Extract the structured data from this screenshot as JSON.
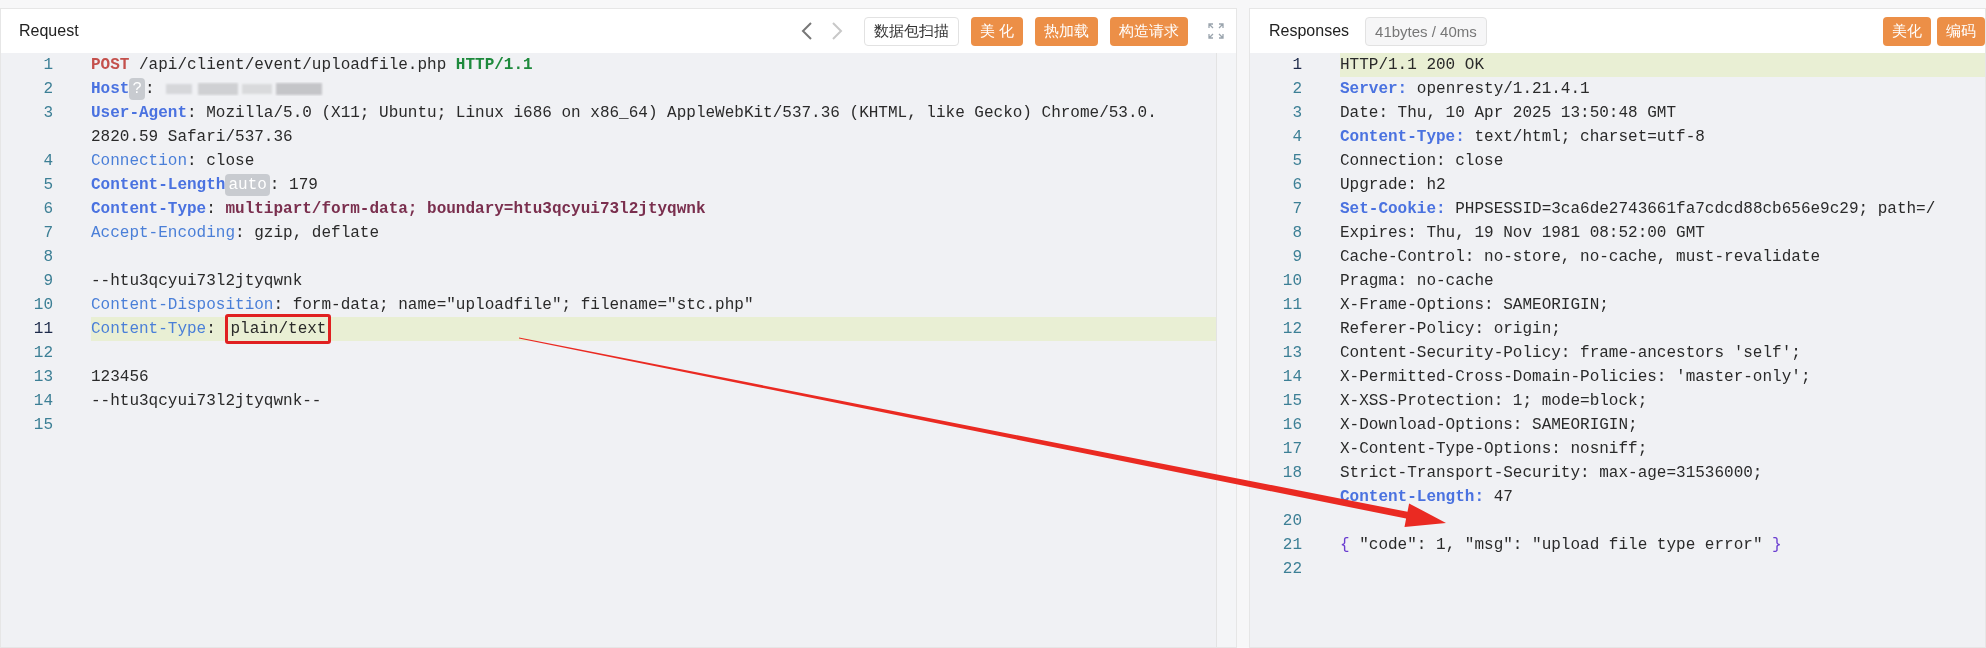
{
  "request": {
    "title": "Request",
    "toolbar": [
      {
        "kind": "back",
        "disabled": false
      },
      {
        "kind": "forward",
        "disabled": true
      },
      {
        "kind": "outline",
        "label": "数据包扫描"
      },
      {
        "kind": "primary",
        "label": "美 化"
      },
      {
        "kind": "primary",
        "label": "热加载"
      },
      {
        "kind": "primary",
        "label": "构造请求"
      },
      {
        "kind": "fullscreen"
      }
    ],
    "lines": [
      {
        "number": "1",
        "current": false,
        "segments": [
          {
            "kind": "method",
            "text": "POST"
          },
          {
            "kind": "plain",
            "text": " /api/client/event/uploadfile.php "
          },
          {
            "kind": "proto",
            "text": "HTTP/1.1"
          }
        ]
      },
      {
        "number": "2",
        "current": false,
        "segments": [
          {
            "kind": "key",
            "text": "Host"
          },
          {
            "kind": "badge",
            "text": "?"
          },
          {
            "kind": "plain",
            "text": ": "
          },
          {
            "kind": "redacted"
          }
        ]
      },
      {
        "number": "3",
        "current": false,
        "segments": [
          {
            "kind": "key",
            "text": "User-Agent"
          },
          {
            "kind": "plain",
            "text": ": Mozilla/5.0 (X11; Ubuntu; Linux i686 on x86_64) AppleWebKit/537.36 (KHTML, like Gecko) Chrome/53.0."
          }
        ],
        "continuation": "2820.59 Safari/537.36"
      },
      {
        "number": "4",
        "current": false,
        "segments": [
          {
            "kind": "name",
            "text": "Connection"
          },
          {
            "kind": "plain",
            "text": ": close"
          }
        ]
      },
      {
        "number": "5",
        "current": false,
        "segments": [
          {
            "kind": "key",
            "text": "Content-Length"
          },
          {
            "kind": "badge",
            "text": "auto"
          },
          {
            "kind": "plain",
            "text": ": 179"
          }
        ]
      },
      {
        "number": "6",
        "current": false,
        "segments": [
          {
            "kind": "key",
            "text": "Content-Type"
          },
          {
            "kind": "plain",
            "text": ": "
          },
          {
            "kind": "strong",
            "text": "multipart/form-data; boundary=htu3qcyui73l2jtyqwnk"
          }
        ]
      },
      {
        "number": "7",
        "current": false,
        "segments": [
          {
            "kind": "name",
            "text": "Accept-Encoding"
          },
          {
            "kind": "plain",
            "text": ": gzip, deflate"
          }
        ]
      },
      {
        "number": "8",
        "current": false
      },
      {
        "number": "9",
        "current": false,
        "segments": [
          {
            "kind": "plain",
            "text": "--htu3qcyui73l2jtyqwnk"
          }
        ]
      },
      {
        "number": "10",
        "current": false,
        "segments": [
          {
            "kind": "name",
            "text": "Content-Disposition"
          },
          {
            "kind": "plain",
            "text": ": form-data; name=\"uploadfile\"; filename=\"stc.php\""
          }
        ]
      },
      {
        "number": "11",
        "current": true,
        "segments": [
          {
            "kind": "name",
            "text": "Content-Type"
          },
          {
            "kind": "plain",
            "text": ": "
          },
          {
            "kind": "boxed",
            "text": "plain/text"
          }
        ]
      },
      {
        "number": "12",
        "current": false
      },
      {
        "number": "13",
        "current": false,
        "segments": [
          {
            "kind": "plain",
            "text": "123456"
          }
        ]
      },
      {
        "number": "14",
        "current": false,
        "segments": [
          {
            "kind": "plain",
            "text": "--htu3qcyui73l2jtyqwnk--"
          }
        ]
      },
      {
        "number": "15",
        "current": false
      }
    ]
  },
  "response": {
    "title": "Responses",
    "stats": "41bytes / 40ms",
    "buttons": [
      "美化",
      "编码"
    ],
    "lines": [
      {
        "number": "1",
        "current": true,
        "segments": [
          {
            "kind": "plain",
            "text": "HTTP/1.1 200 OK"
          }
        ]
      },
      {
        "number": "2",
        "current": false,
        "segments": [
          {
            "kind": "key",
            "text": "Server:"
          },
          {
            "kind": "plain",
            "text": " openresty/1.21.4.1"
          }
        ]
      },
      {
        "number": "3",
        "current": false,
        "segments": [
          {
            "kind": "plain",
            "text": "Date: Thu, 10 Apr 2025 13:50:48 GMT"
          }
        ]
      },
      {
        "number": "4",
        "current": false,
        "segments": [
          {
            "kind": "key",
            "text": "Content-Type:"
          },
          {
            "kind": "plain",
            "text": " text/html; charset=utf-8"
          }
        ]
      },
      {
        "number": "5",
        "current": false,
        "segments": [
          {
            "kind": "plain",
            "text": "Connection: close"
          }
        ]
      },
      {
        "number": "6",
        "current": false,
        "segments": [
          {
            "kind": "plain",
            "text": "Upgrade: h2"
          }
        ]
      },
      {
        "number": "7",
        "current": false,
        "segments": [
          {
            "kind": "key",
            "text": "Set-Cookie:"
          },
          {
            "kind": "plain",
            "text": " PHPSESSID=3ca6de2743661fa7cdcd88cb656e9c29; path=/"
          }
        ]
      },
      {
        "number": "8",
        "current": false,
        "segments": [
          {
            "kind": "plain",
            "text": "Expires: Thu, 19 Nov 1981 08:52:00 GMT"
          }
        ]
      },
      {
        "number": "9",
        "current": false,
        "segments": [
          {
            "kind": "plain",
            "text": "Cache-Control: no-store, no-cache, must-revalidate"
          }
        ]
      },
      {
        "number": "10",
        "current": false,
        "segments": [
          {
            "kind": "plain",
            "text": "Pragma: no-cache"
          }
        ]
      },
      {
        "number": "11",
        "current": false,
        "segments": [
          {
            "kind": "plain",
            "text": "X-Frame-Options: SAMEORIGIN;"
          }
        ]
      },
      {
        "number": "12",
        "current": false,
        "segments": [
          {
            "kind": "plain",
            "text": "Referer-Policy: origin;"
          }
        ]
      },
      {
        "number": "13",
        "current": false,
        "segments": [
          {
            "kind": "plain",
            "text": "Content-Security-Policy: frame-ancestors 'self';"
          }
        ]
      },
      {
        "number": "14",
        "current": false,
        "segments": [
          {
            "kind": "plain",
            "text": "X-Permitted-Cross-Domain-Policies: 'master-only';"
          }
        ]
      },
      {
        "number": "15",
        "current": false,
        "segments": [
          {
            "kind": "plain",
            "text": "X-XSS-Protection: 1; mode=block;"
          }
        ]
      },
      {
        "number": "16",
        "current": false,
        "segments": [
          {
            "kind": "plain",
            "text": "X-Download-Options: SAMEORIGIN;"
          }
        ]
      },
      {
        "number": "17",
        "current": false,
        "segments": [
          {
            "kind": "plain",
            "text": "X-Content-Type-Options: nosniff;"
          }
        ]
      },
      {
        "number": "18",
        "current": false,
        "segments": [
          {
            "kind": "plain",
            "text": "Strict-Transport-Security: max-age=31536000;"
          }
        ]
      },
      {
        "current": false,
        "segments": [
          {
            "kind": "key",
            "text": "Content-Length:"
          },
          {
            "kind": "plain",
            "text": " 47"
          }
        ]
      },
      {
        "number": "20",
        "current": false
      },
      {
        "number": "21",
        "current": false,
        "segments": [
          {
            "kind": "brace",
            "text": "{"
          },
          {
            "kind": "plain",
            "text": " \"code\": 1, \"msg\": \"upload file type error\" "
          },
          {
            "kind": "brace",
            "text": "}"
          }
        ]
      },
      {
        "number": "22",
        "current": false
      }
    ]
  }
}
